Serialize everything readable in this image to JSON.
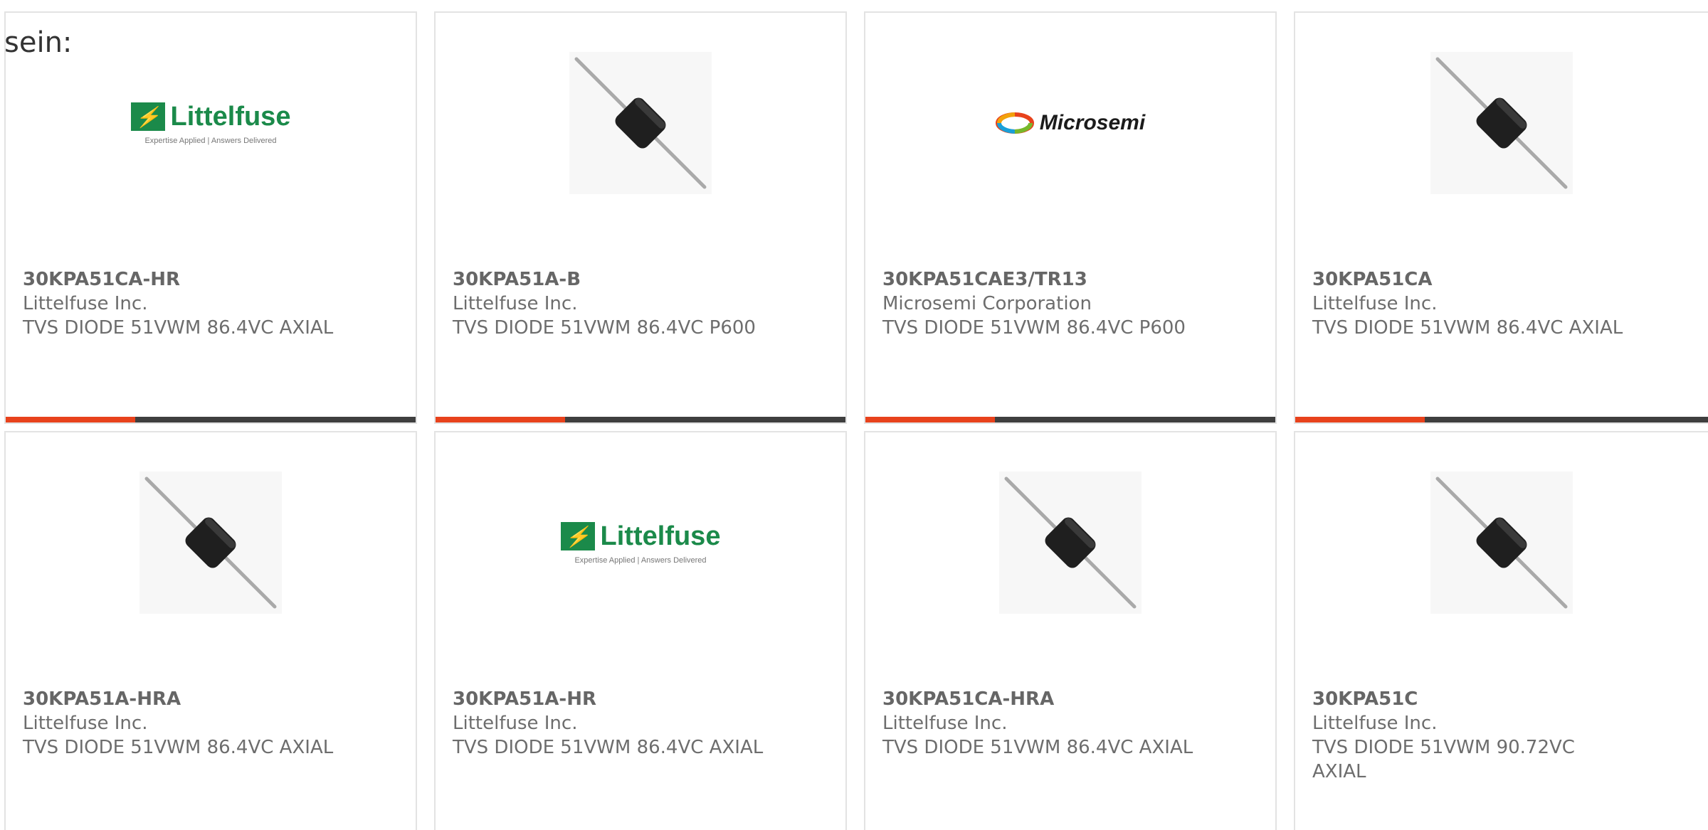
{
  "intro_text": "sein:",
  "colors": {
    "accent": "#e8421c",
    "bar_dark": "#3f3f3f",
    "littelfuse_green": "#1b8a4a"
  },
  "brand_logos": {
    "littelfuse": {
      "name": "Littelfuse",
      "tagline": "Expertise Applied | Answers Delivered"
    },
    "microsemi": {
      "name": "Microsemi"
    }
  },
  "products": [
    {
      "part_number": "30KPA51CA-HR",
      "manufacturer": "Littelfuse Inc.",
      "description": "TVS DIODE 51VWM 86.4VC AXIAL",
      "image": "littelfuse-logo"
    },
    {
      "part_number": "30KPA51A-B",
      "manufacturer": "Littelfuse Inc.",
      "description": "TVS DIODE 51VWM 86.4VC P600",
      "image": "axial-diode"
    },
    {
      "part_number": "30KPA51CAE3/TR13",
      "manufacturer": "Microsemi Corporation",
      "description": "TVS DIODE 51VWM 86.4VC P600",
      "image": "microsemi-logo"
    },
    {
      "part_number": "30KPA51CA",
      "manufacturer": "Littelfuse Inc.",
      "description": "TVS DIODE 51VWM 86.4VC AXIAL",
      "image": "axial-diode"
    },
    {
      "part_number": "30KPA51A-HRA",
      "manufacturer": "Littelfuse Inc.",
      "description": "TVS DIODE 51VWM 86.4VC AXIAL",
      "image": "axial-diode"
    },
    {
      "part_number": "30KPA51A-HR",
      "manufacturer": "Littelfuse Inc.",
      "description": "TVS DIODE 51VWM 86.4VC AXIAL",
      "image": "littelfuse-logo"
    },
    {
      "part_number": "30KPA51CA-HRA",
      "manufacturer": "Littelfuse Inc.",
      "description": "TVS DIODE 51VWM 86.4VC AXIAL",
      "image": "axial-diode"
    },
    {
      "part_number": "30KPA51C",
      "manufacturer": "Littelfuse Inc.",
      "description": "TVS DIODE 51VWM 90.72VC AXIAL",
      "image": "axial-diode"
    }
  ]
}
